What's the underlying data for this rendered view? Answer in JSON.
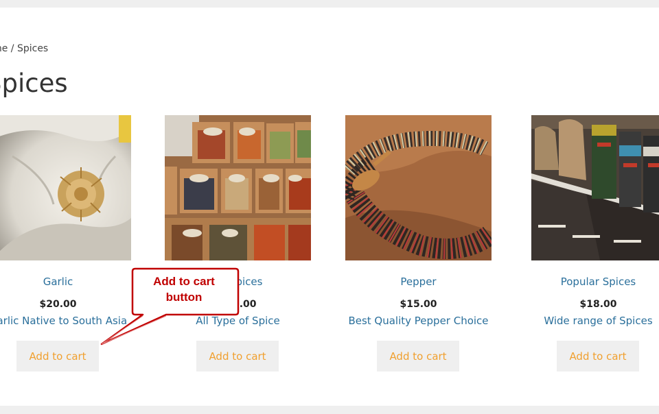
{
  "breadcrumb": "Home / Spices",
  "page_title": "Spices",
  "products": [
    {
      "name": "Garlic",
      "price": "$20.00",
      "description": "Garlic Native to South Asia",
      "button": "Add to cart"
    },
    {
      "name": "All Spices",
      "price": "$10.00",
      "description": "All Type of Spice",
      "button": "Add to cart"
    },
    {
      "name": "Pepper",
      "price": "$15.00",
      "description": "Best Quality Pepper Choice",
      "button": "Add to cart"
    },
    {
      "name": "Popular Spices",
      "price": "$18.00",
      "description": "Wide range of Spices",
      "button": "Add to cart"
    }
  ],
  "callout": {
    "line1": "Add to cart",
    "line2": "button"
  },
  "colors": {
    "link": "#2a6f9b",
    "button_text": "#f0a02f",
    "button_bg": "#efefef",
    "callout_border": "#c00000"
  }
}
